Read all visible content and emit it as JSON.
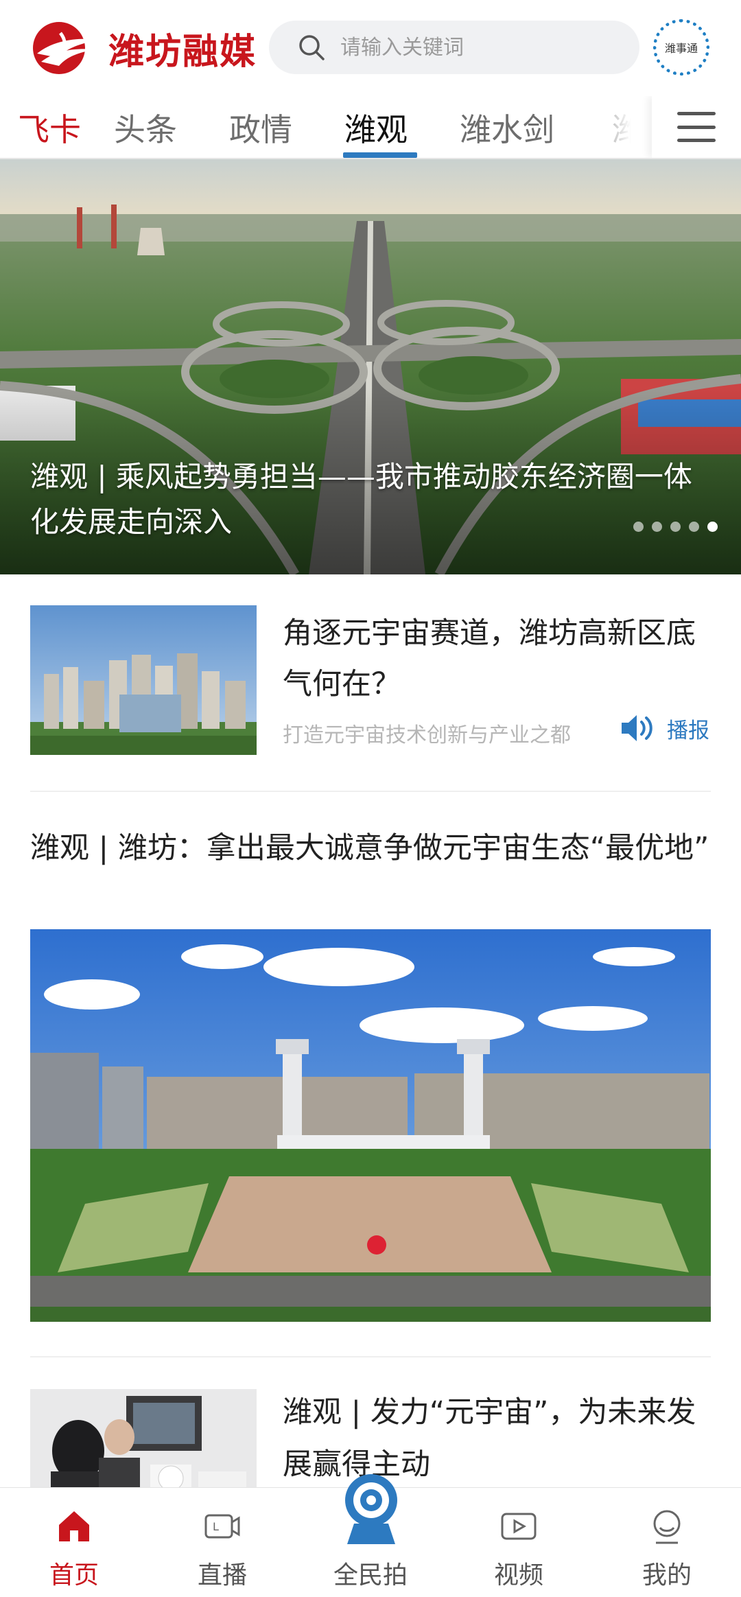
{
  "header": {
    "logo_text": "潍坊融媒",
    "search_placeholder": "请输入关键词",
    "service_label": "潍事通"
  },
  "tabs": [
    {
      "label": "飞卡"
    },
    {
      "label": "头条"
    },
    {
      "label": "政情"
    },
    {
      "label": "潍观"
    },
    {
      "label": "潍水剑"
    },
    {
      "label": "潍视"
    }
  ],
  "active_tab": "潍观",
  "hero": {
    "title": "潍观 | 乘风起势勇担当——我市推动胶东经济圈一体化发展走向深入",
    "dots_total": 5,
    "dots_active_index": 5
  },
  "articles": [
    {
      "title": "角逐元宇宙赛道，潍坊高新区底气何在？",
      "subtitle": "打造元宇宙技术创新与产业之都",
      "action_label": "播报"
    },
    {
      "title": "潍观 | 潍坊：拿出最大诚意争做元宇宙生态“最优地”"
    },
    {
      "title": "潍观 | 发力“元宇宙”，为未来发展赢得主动"
    }
  ],
  "bottom_nav": [
    {
      "label": "首页",
      "icon": "home-icon"
    },
    {
      "label": "直播",
      "icon": "live-icon"
    },
    {
      "label": "全民拍",
      "icon": "camera-icon"
    },
    {
      "label": "视频",
      "icon": "video-icon"
    },
    {
      "label": "我的",
      "icon": "profile-icon"
    }
  ],
  "colors": {
    "brand_red": "#c8161d",
    "accent_blue": "#2d7ac0"
  }
}
